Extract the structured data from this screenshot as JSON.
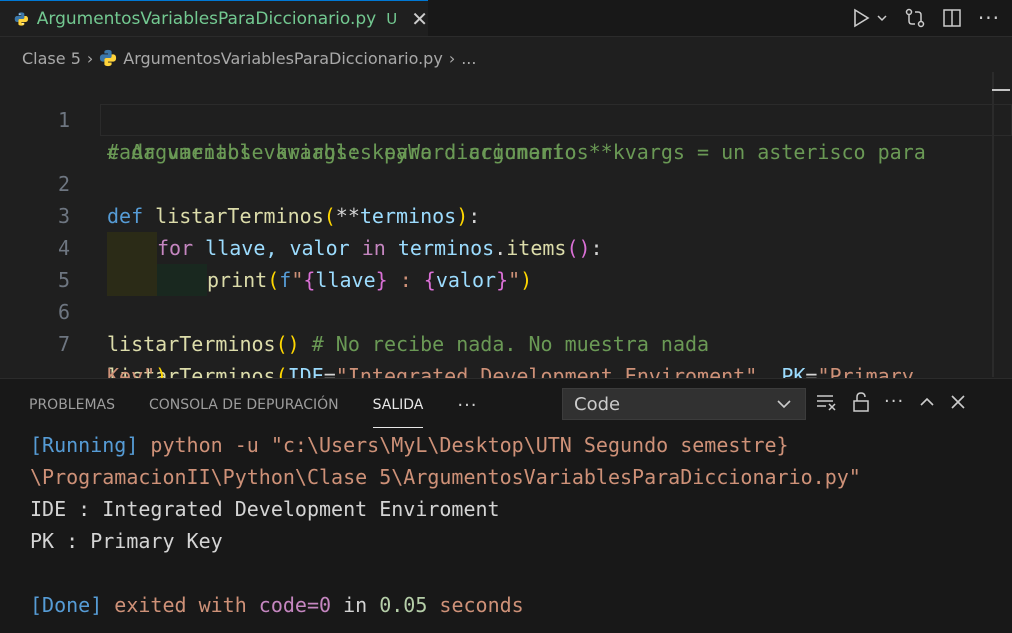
{
  "tab": {
    "filename": "ArgumentosVariablesParaDiccionario.py",
    "status": "U"
  },
  "breadcrumb": {
    "folder": "Clase 5",
    "file": "ArgumentosVariablesParaDiccionario.py",
    "more": "..."
  },
  "editor": {
    "line_numbers": [
      "1",
      "2",
      "3",
      "4",
      "5",
      "6",
      "7"
    ],
    "l1a": "# Argumentos variables para diccionario **kvargs = un asterisco para",
    "l1b": "cada variable kwargs: keyWord argumentos",
    "l2_def": "def",
    "l2_name": "listarTerminos",
    "l2_open": "(",
    "l2_stars": "**",
    "l2_param": "terminos",
    "l2_close": ")",
    "l2_colon": ":",
    "l3_for": "for",
    "l3_vars": "llave, valor",
    "l3_in": "in",
    "l3_obj": "terminos",
    "l3_dot": ".",
    "l3_items": "items",
    "l3_paren": "()",
    "l3_colon": ":",
    "l4_print": "print",
    "l4_open": "(",
    "l4_f": "f",
    "l4_q1": "\"",
    "l4_b1": "{",
    "l4_k": "llave",
    "l4_b2": "}",
    "l4_sep": " : ",
    "l4_b3": "{",
    "l4_v": "valor",
    "l4_b4": "}",
    "l4_q2": "\"",
    "l4_close": ")",
    "l6_call": "listarTerminos",
    "l6_paren": "()",
    "l6_comment": "# No recibe nada. No muestra nada",
    "l7_call": "listarTerminos",
    "l7_open": "(",
    "l7_k1": "IDE",
    "l7_eq1": "=",
    "l7_s1": "\"Integrated Development Enviroment\"",
    "l7_comma": ", ",
    "l7_k2": "PK",
    "l7_eq2": "=",
    "l7_s2a": "\"Primary",
    "l7_s2b": "Key\"",
    "l7_close": ")"
  },
  "panel": {
    "tabs": [
      "PROBLEMAS",
      "CONSOLA DE DEPURACIÓN",
      "SALIDA"
    ],
    "active_tab": "SALIDA",
    "more": "···",
    "select_value": "Code",
    "output": {
      "running_tag": "[Running]",
      "cmd1": " python -u \"c:\\Users\\MyL\\Desktop\\UTN Segundo semestre}",
      "cmd2": "\\ProgramacionII\\Python\\Clase 5\\ArgumentosVariablesParaDiccionario.py\"",
      "res1": "IDE : Integrated Development Enviroment",
      "res2": "PK : Primary Key",
      "done_tag": "[Done]",
      "done_a": " exited with ",
      "done_code": "code=0",
      "done_b": " in ",
      "done_time": "0.05",
      "done_c": " seconds"
    }
  },
  "colors": {
    "accent": "#0078d4",
    "untracked": "#73c991"
  }
}
